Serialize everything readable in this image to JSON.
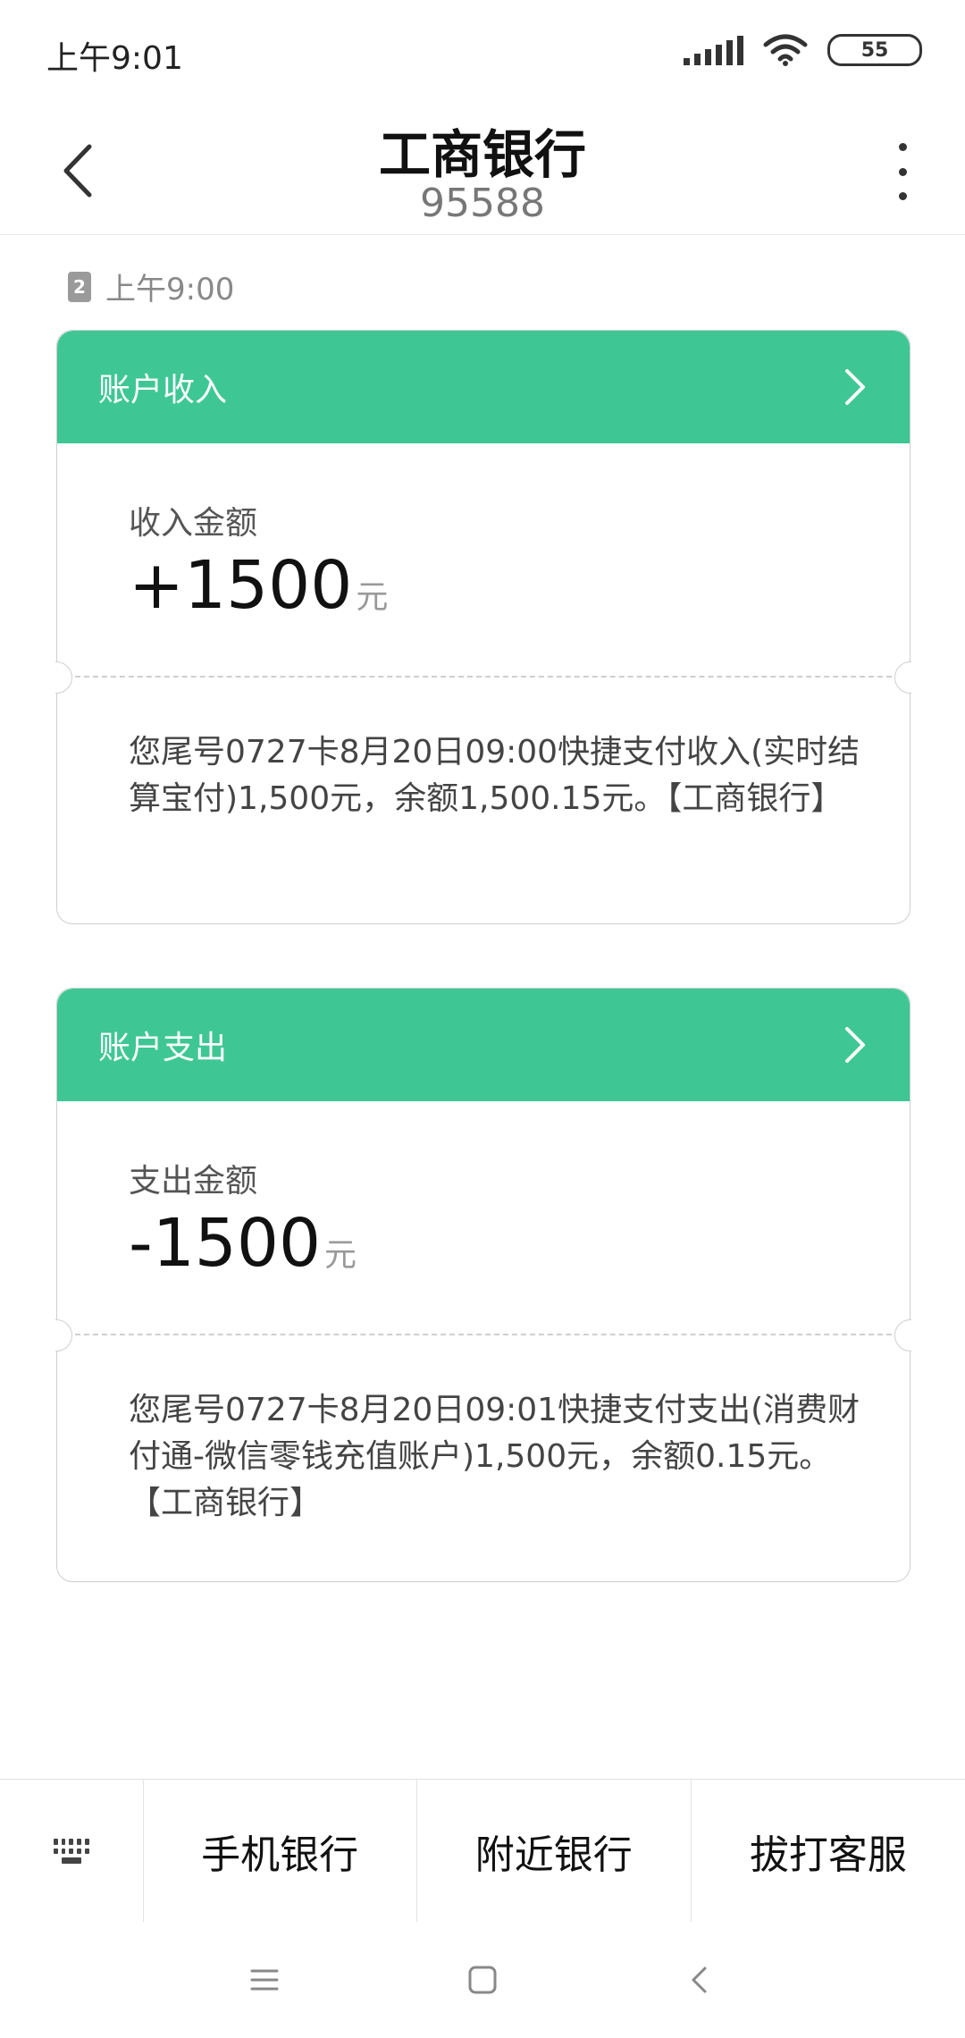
{
  "status_bar": {
    "time": "上午9:01",
    "battery": "55"
  },
  "header": {
    "title": "工商银行",
    "subtitle": "95588"
  },
  "message": {
    "sim": "2",
    "time": "上午9:00"
  },
  "cards": [
    {
      "title": "账户收入",
      "amount_label": "收入金额",
      "amount": "+1500",
      "unit": "元",
      "text": "您尾号0727卡8月20日09:00快捷支付收入(实时结算宝付)1,500元，余额1,500.15元。【工商银行】"
    },
    {
      "title": "账户支出",
      "amount_label": "支出金额",
      "amount": "-1500",
      "unit": "元",
      "text": "您尾号0727卡8月20日09:01快捷支付支出(消费财付通-微信零钱充值账户)1,500元，余额0.15元。【工商银行】"
    }
  ],
  "bottom_bar": {
    "items": [
      "手机银行",
      "附近银行",
      "拔打客服"
    ]
  },
  "colors": {
    "accent": "#3ec794"
  }
}
